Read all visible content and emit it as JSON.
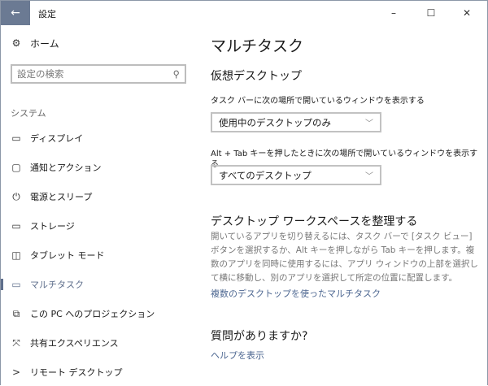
{
  "window": {
    "title": "設定",
    "back_icon": "arrow-left",
    "minimize": "–",
    "maximize": "☐",
    "close": "✕"
  },
  "sidebar": {
    "home": "ホーム",
    "search_placeholder": "設定の検索",
    "category": "システム",
    "items": [
      {
        "label": "ディスプレイ",
        "icon": "display"
      },
      {
        "label": "通知とアクション",
        "icon": "notification"
      },
      {
        "label": "電源とスリープ",
        "icon": "power"
      },
      {
        "label": "ストレージ",
        "icon": "storage"
      },
      {
        "label": "タブレット モード",
        "icon": "tablet"
      },
      {
        "label": "マルチタスク",
        "icon": "multitask",
        "selected": true
      },
      {
        "label": "この PC へのプロジェクション",
        "icon": "projection"
      },
      {
        "label": "共有エクスペリエンス",
        "icon": "shared"
      },
      {
        "label": "リモート デスクトップ",
        "icon": "remote"
      }
    ]
  },
  "main": {
    "title": "マルチタスク",
    "virtual_desktops": {
      "heading": "仮想デスクトップ",
      "taskbar_label": "タスク バーに次の場所で開いているウィンドウを表示する",
      "taskbar_value": "使用中のデスクトップのみ",
      "alttab_label": "Alt + Tab キーを押したときに次の場所で開いているウィンドウを表示する",
      "alttab_value": "すべてのデスクトップ"
    },
    "workspace": {
      "heading": "デスクトップ ワークスペースを整理する",
      "body": "開いているアプリを切り替えるには、タスク バーで [タスク ビュー] ボタンを選択するか、Alt キーを押しながら Tab キーを押します。複数のアプリを同時に使用するには、アプリ ウィンドウの上部を選択して横に移動し、別のアプリを選択して所定の位置に配置します。",
      "link": "複数のデスクトップを使ったマルチタスク"
    },
    "help": {
      "heading": "質問がありますか?",
      "link": "ヘルプを表示"
    }
  },
  "colors": {
    "accent": "#5f6f8c",
    "back_button": "#6b7a93",
    "link": "#4d6791"
  }
}
